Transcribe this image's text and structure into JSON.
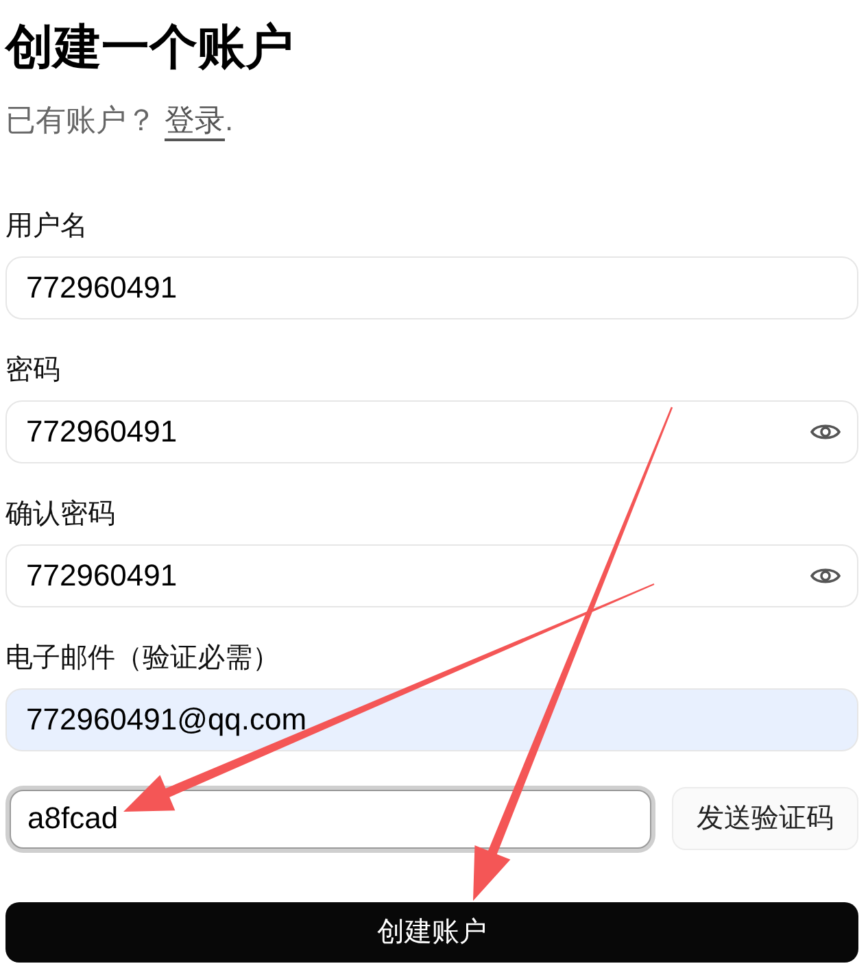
{
  "heading": "创建一个账户",
  "login_prompt": {
    "text": "已有账户？",
    "link": "登录",
    "trailing": "."
  },
  "fields": [
    {
      "label": "用户名",
      "value": "772960491",
      "kind": "text"
    },
    {
      "label": "密码",
      "value": "772960491",
      "kind": "password"
    },
    {
      "label": "确认密码",
      "value": "772960491",
      "kind": "password"
    },
    {
      "label": "电子邮件（验证必需）",
      "value": "772960491@qq.com",
      "kind": "autofilled"
    }
  ],
  "verification": {
    "value": "a8fcad",
    "focused": true,
    "button": "发送验证码"
  },
  "submit_button": "创建账户"
}
